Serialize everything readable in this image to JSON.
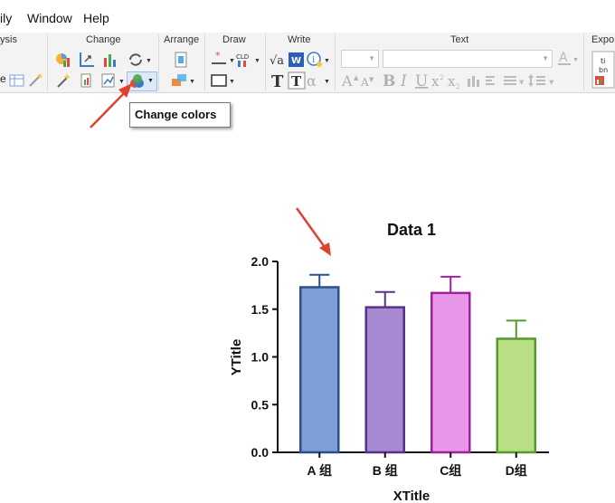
{
  "menu": {
    "partial": "ily",
    "window": "Window",
    "help": "Help"
  },
  "ribbon": {
    "groups": {
      "analysis": "ysis",
      "change": "Change",
      "arrange": "Arrange",
      "draw": "Draw",
      "write": "Write",
      "text": "Text",
      "export": "Expo"
    },
    "partial_left": "e"
  },
  "tooltip": {
    "text": "Change colors"
  },
  "colors": {
    "accent_arrow": "#e0402f",
    "bar_A": "#7b9fd6",
    "bar_A_edge": "#2f4f8a",
    "bar_B": "#a58ad2",
    "bar_B_edge": "#5a2e8c",
    "bar_C": "#e897e8",
    "bar_C_edge": "#a0209c",
    "bar_D": "#b9de84",
    "bar_D_edge": "#559a2c"
  },
  "chart_data": {
    "type": "bar",
    "title": "Data 1",
    "xlabel": "XTitle",
    "ylabel": "YTitle",
    "categories": [
      "A 组",
      "B 组",
      "C组",
      "D组"
    ],
    "values": [
      1.73,
      1.52,
      1.67,
      1.19
    ],
    "errors": [
      0.13,
      0.16,
      0.17,
      0.19
    ],
    "ylim": [
      0,
      2.0
    ],
    "yticks": [
      "0.0",
      "0.5",
      "1.0",
      "1.5",
      "2.0"
    ],
    "grid": false
  }
}
